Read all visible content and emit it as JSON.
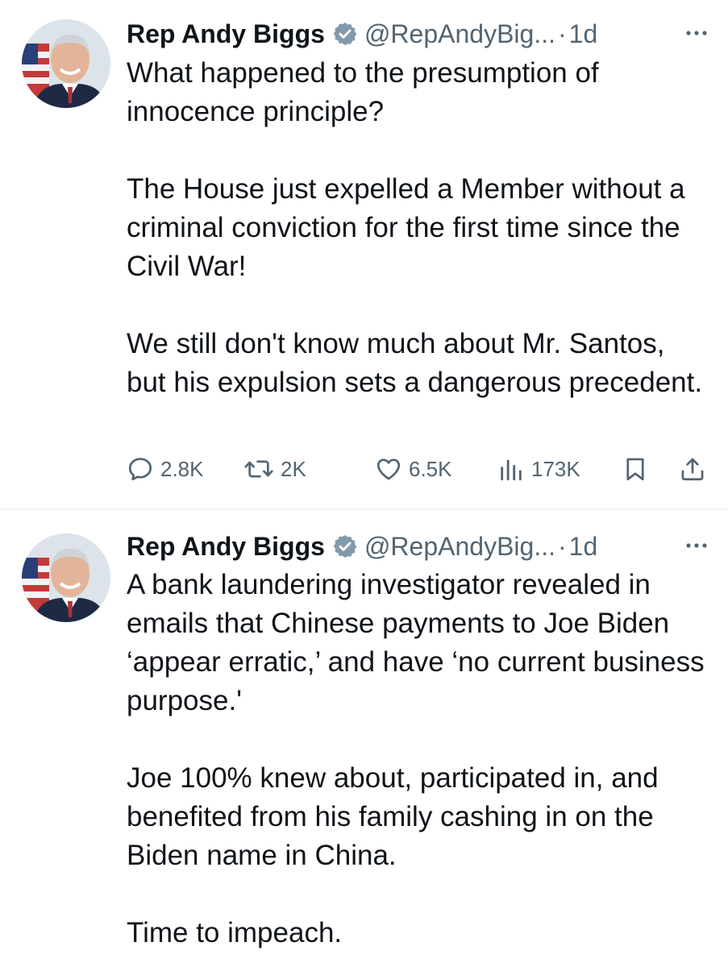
{
  "tweets": [
    {
      "author": {
        "display_name": "Rep Andy Biggs",
        "handle": "@RepAndyBig...",
        "verified_icon": "verified-badge-icon",
        "avatar": "avatar-photo"
      },
      "separator": "·",
      "time": "1d",
      "paragraphs": [
        "What happened to the presumption of innocence principle?",
        "The House just expelled a Member without a criminal conviction for the first time since the Civil War!",
        "We still don't know much about Mr. Santos, but his expulsion sets a dangerous precedent."
      ],
      "stats": {
        "replies": "2.8K",
        "reposts": "2K",
        "likes": "6.5K",
        "views": "173K"
      }
    },
    {
      "author": {
        "display_name": "Rep Andy Biggs",
        "handle": "@RepAndyBig...",
        "verified_icon": "verified-badge-icon",
        "avatar": "avatar-photo"
      },
      "separator": "·",
      "time": "1d",
      "paragraphs": [
        "A bank laundering investigator revealed in emails that Chinese payments to Joe Biden ‘appear erratic,’ and have ‘no current business purpose.'",
        "Joe 100% knew about, participated in, and benefited from his family cashing in on the Biden name in China.",
        "Time to impeach."
      ]
    }
  ],
  "colors": {
    "text": "#0f1419",
    "secondary": "#536471",
    "verified": "#829aab",
    "divider": "#eff3f4"
  }
}
